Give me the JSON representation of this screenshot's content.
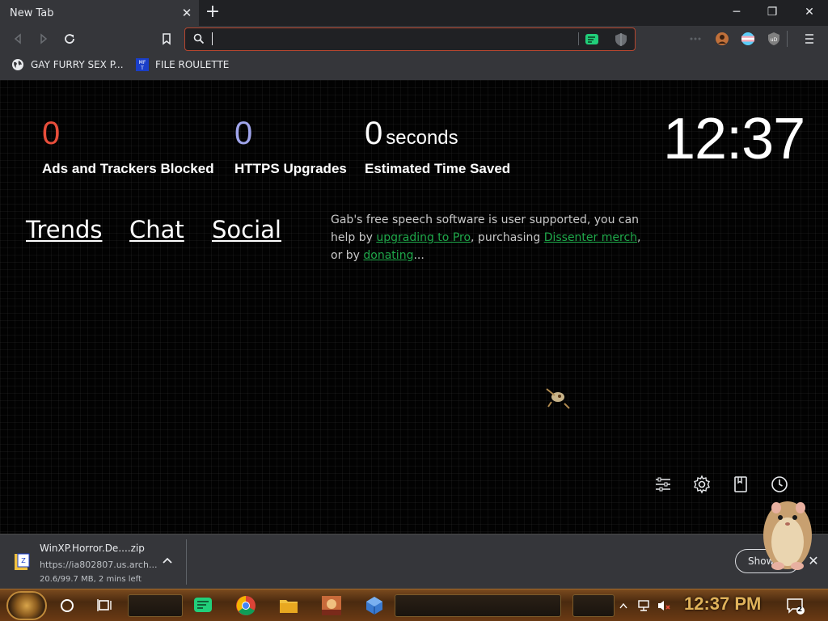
{
  "browser": {
    "tab_title": "New Tab",
    "tab_close": "✕",
    "new_tab": "+",
    "window": {
      "minimize": "─",
      "restore": "❐",
      "close": "✕"
    }
  },
  "omnibox": {
    "value": "",
    "placeholder": ""
  },
  "bookmarks": [
    {
      "label": "GAY FURRY SEX P...",
      "icon": "globe-icon"
    },
    {
      "label": "FILE ROULETTE",
      "icon": "mft-icon"
    }
  ],
  "stats": [
    {
      "value": "0",
      "unit": "",
      "label": "Ads and Trackers Blocked",
      "color": "#e84e3b"
    },
    {
      "value": "0",
      "unit": "",
      "label": "HTTPS Upgrades",
      "color": "#a0a5eb"
    },
    {
      "value": "0",
      "unit": "seconds",
      "label": "Estimated Time Saved",
      "color": "#ffffff"
    }
  ],
  "clock": "12:37",
  "nav_links": [
    "Trends",
    "Chat",
    "Social"
  ],
  "promo": {
    "text1": "Gab's free speech software is user supported, you can help by ",
    "link1": "upgrading to Pro",
    "text2": ", purchasing ",
    "link2": "Dissenter merch",
    "text3": ", or by ",
    "link3": "donating",
    "text4": "..."
  },
  "download": {
    "filename": "WinXP.Horror.De....zip",
    "url": "https://ia802807.us.arch...",
    "progress": "20.6/99.7 MB, 2 mins left",
    "show_all": "Show all",
    "close": "✕"
  },
  "taskbar": {
    "clock": "12:37 PM",
    "notifications": "2"
  },
  "colors": {
    "accent_red": "#e84e3b",
    "https_purple": "#a0a5eb",
    "link_green": "#1fa84a",
    "omnibox_border": "#b5462f"
  }
}
